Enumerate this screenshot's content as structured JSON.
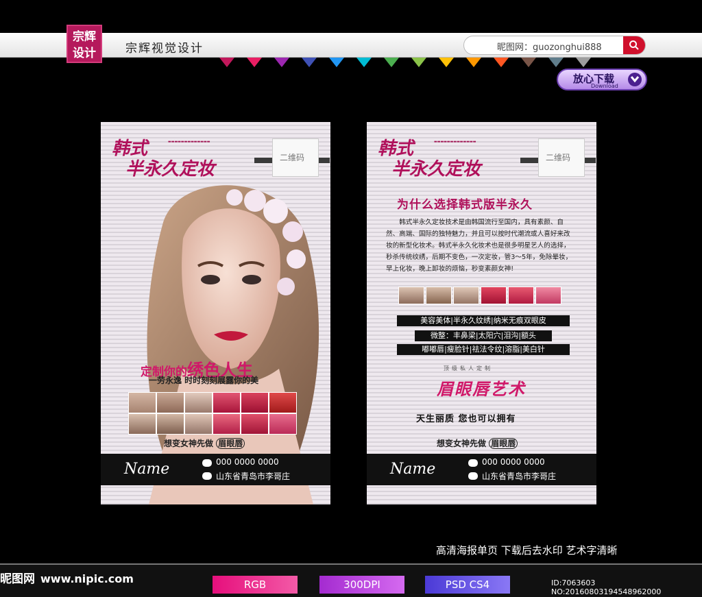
{
  "header": {
    "logo_text": "宗辉设计",
    "site_title": "宗辉视觉设计",
    "search_label": "昵图网：",
    "search_value": "guozonghui888",
    "download_label": "放心下载",
    "download_sub": "Download"
  },
  "poster_left": {
    "brand_line1": "韩式",
    "brand_line2": "半永久定妆",
    "qr_label": "二维码",
    "slogan_a": "定制你的",
    "slogan_b": "绣色人生",
    "subslogan": "一劳永逸 时时刻刻展露你的美",
    "wish": "想变女神先做",
    "wish_mark": "眉眼唇",
    "phone": "000 0000 0000",
    "address": "山东省青岛市李哥庄",
    "name": "Name"
  },
  "poster_right": {
    "brand_line1": "韩式",
    "brand_line2": "半永久定妆",
    "qr_label": "二维码",
    "heading": "为什么选择韩式版半永久",
    "body": "韩式半永久定妆技术是由韩国流行至国内，具有素颜、自然、高端、国际的独特魅力，并且可以按时代潮流或人喜好来改妆的新型化妆术。韩式半永久化妆术也是很多明星艺人的选择，秒杀传统纹绣，后期不变色，一次定妆，管3～5年，免除晕妆，早上化妆，晚上卸妆的烦恼，秒变素颜女神!",
    "services": [
      "美容美体|半永久纹绣|纳米无痕双眼皮",
      "微整：丰鼻梁|太阳穴|泪沟|额头",
      "嘟嘟唇|瘦脸针|祛法令纹|溶脂|美白针"
    ],
    "art_small": "顶级私人定制",
    "art_title": "眉眼唇艺术",
    "quote": "天生丽质  您也可以拥有",
    "wish": "想变女神先做",
    "wish_mark": "眉眼唇",
    "phone": "000 0000 0000",
    "address": "山东省青岛市李哥庄",
    "name": "Name"
  },
  "tagline": "高清海报单页 下载后去水印 艺术字清晰",
  "footer": {
    "site": "昵图网",
    "url": "www.nipic.com",
    "badge_rgb": "RGB",
    "badge_dpi": "300DPI",
    "badge_psd": "PSD CS4",
    "id_text": "ID:7063603 NO:20160803194548962000"
  },
  "colors": {
    "accent": "#b0115b",
    "rgb_badge": "#e60f7c",
    "dpi_badge": "#a42bd0",
    "psd_badge": "#4b3ad6"
  }
}
